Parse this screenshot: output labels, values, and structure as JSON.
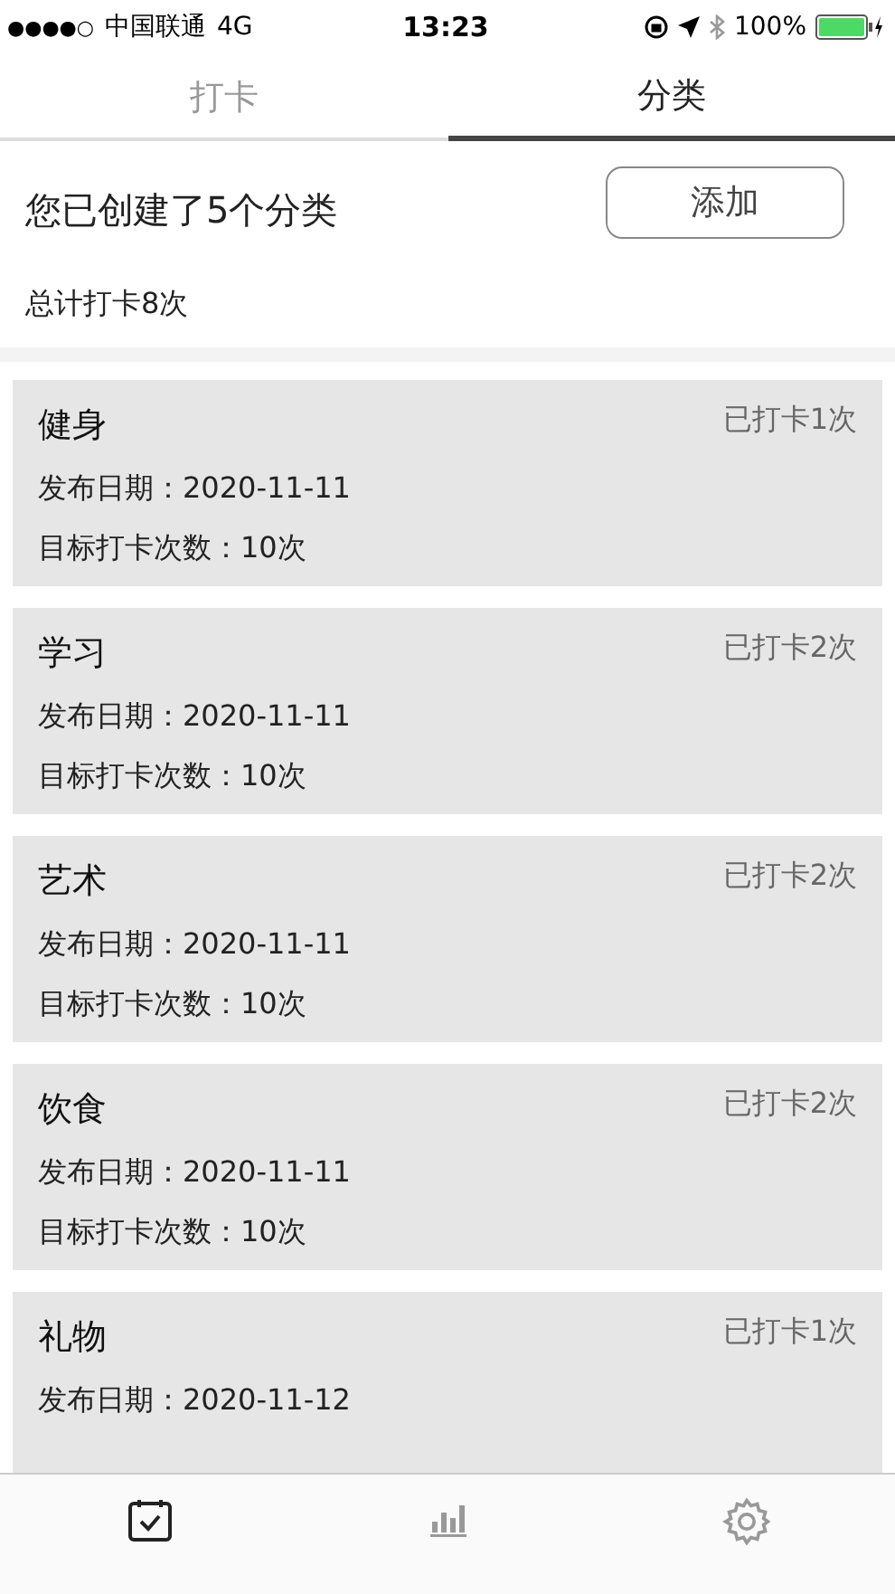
{
  "status_bar": {
    "signal": "●●●●○",
    "carrier": "中国联通",
    "network": "4G",
    "time": "13:23",
    "battery": "100%"
  },
  "tabs": [
    {
      "label": "打卡",
      "selected": false
    },
    {
      "label": "分类",
      "selected": true
    }
  ],
  "summary": {
    "created": "您已创建了5个分类",
    "add_button": "添加",
    "total": "总计打卡8次"
  },
  "categories": [
    {
      "name": "健身",
      "count": "已打卡1次",
      "date": "发布日期：2020-11-11",
      "target": "目标打卡次数：10次"
    },
    {
      "name": "学习",
      "count": "已打卡2次",
      "date": "发布日期：2020-11-11",
      "target": "目标打卡次数：10次"
    },
    {
      "name": "艺术",
      "count": "已打卡2次",
      "date": "发布日期：2020-11-11",
      "target": "目标打卡次数：10次"
    },
    {
      "name": "饮食",
      "count": "已打卡2次",
      "date": "发布日期：2020-11-11",
      "target": "目标打卡次数：10次"
    },
    {
      "name": "礼物",
      "count": "已打卡1次",
      "date": "发布日期：2020-11-12"
    }
  ],
  "bottom_nav": [
    {
      "kind": "checkin",
      "selected": true
    },
    {
      "kind": "stats",
      "selected": false
    },
    {
      "kind": "settings",
      "selected": false
    }
  ]
}
